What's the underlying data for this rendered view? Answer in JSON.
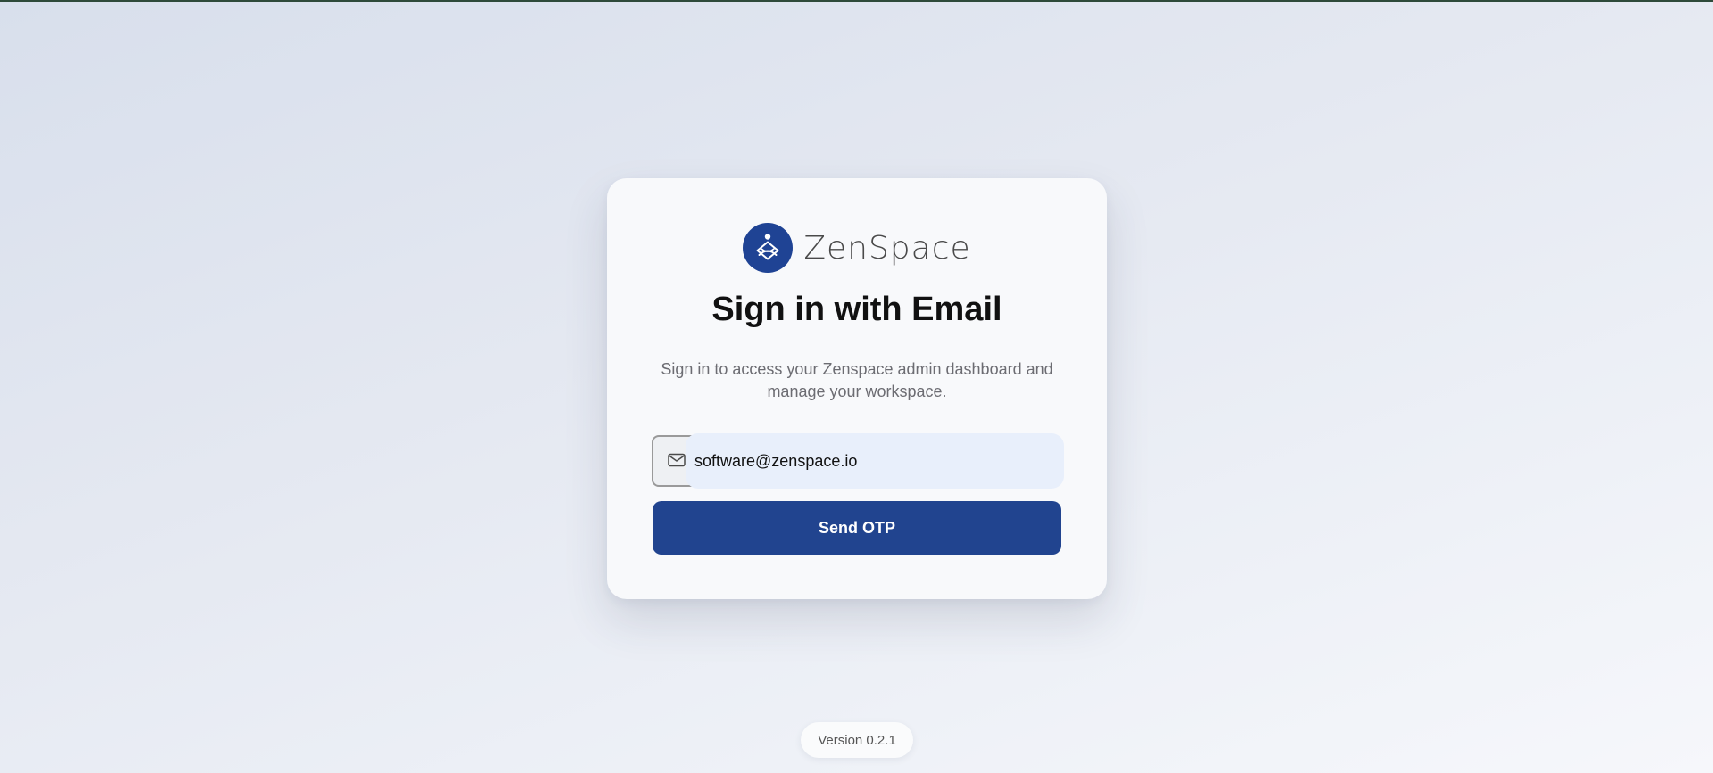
{
  "brand": {
    "name": "ZenSpace",
    "logo_icon": "meditation-figure-icon",
    "logo_color": "#1f4394"
  },
  "signin": {
    "title": "Sign in with Email",
    "subtitle": "Sign in to access your Zenspace admin dashboard and manage your workspace."
  },
  "email_field": {
    "icon": "mail-icon",
    "value": "software@zenspace.io"
  },
  "send_button": {
    "label": "Send OTP",
    "color": "#21448f"
  },
  "footer": {
    "version": "Version 0.2.1"
  }
}
